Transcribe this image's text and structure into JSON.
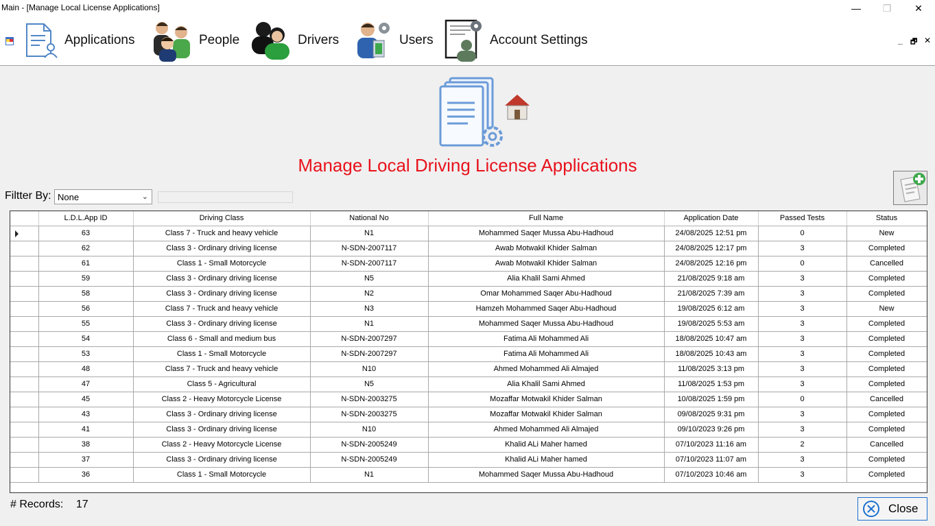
{
  "window": {
    "title": "Main - [Manage Local License Applications]",
    "minimize": "—",
    "maximize": "❐",
    "close": "✕"
  },
  "menu": {
    "items": [
      {
        "label": "Applications",
        "icon": "applications-icon"
      },
      {
        "label": "People",
        "icon": "people-icon"
      },
      {
        "label": "Drivers",
        "icon": "drivers-icon"
      },
      {
        "label": "Users",
        "icon": "users-icon"
      },
      {
        "label": "Account Settings",
        "icon": "account-settings-icon"
      }
    ],
    "mdi_controls": {
      "minimize": "_",
      "restore": "🗗",
      "close": "✕"
    }
  },
  "page": {
    "title": "Manage Local Driving License Applications",
    "title_color": "#e8121c"
  },
  "filter": {
    "label": "Filtter By:",
    "selected": "None",
    "text_value": ""
  },
  "table": {
    "columns": [
      "L.D.L.App ID",
      "Driving Class",
      "National No",
      "Full Name",
      "Application Date",
      "Passed Tests",
      "Status"
    ],
    "rows": [
      [
        "63",
        "Class 7 - Truck and heavy vehicle",
        "N1",
        "Mohammed Saqer Mussa Abu-Hadhoud",
        "24/08/2025 12:51 pm",
        "0",
        "New"
      ],
      [
        "62",
        "Class 3 - Ordinary driving license",
        "N-SDN-2007117",
        "Awab Motwakil Khider Salman",
        "24/08/2025 12:17 pm",
        "3",
        "Completed"
      ],
      [
        "61",
        "Class 1 - Small Motorcycle",
        "N-SDN-2007117",
        "Awab Motwakil Khider Salman",
        "24/08/2025 12:16 pm",
        "0",
        "Cancelled"
      ],
      [
        "59",
        "Class 3 - Ordinary driving license",
        "N5",
        "Alia Khalil Sami Ahmed",
        "21/08/2025 9:18 am",
        "3",
        "Completed"
      ],
      [
        "58",
        "Class 3 - Ordinary driving license",
        "N2",
        "Omar Mohammed Saqer Abu-Hadhoud",
        "21/08/2025 7:39 am",
        "3",
        "Completed"
      ],
      [
        "56",
        "Class 7 - Truck and heavy vehicle",
        "N3",
        "Hamzeh Mohammed Saqer Abu-Hadhoud",
        "19/08/2025 6:12 am",
        "3",
        "New"
      ],
      [
        "55",
        "Class 3 - Ordinary driving license",
        "N1",
        "Mohammed Saqer Mussa Abu-Hadhoud",
        "19/08/2025 5:53 am",
        "3",
        "Completed"
      ],
      [
        "54",
        "Class 6 - Small and medium bus",
        "N-SDN-2007297",
        "Fatima Ali Mohammed Ali",
        "18/08/2025 10:47 am",
        "3",
        "Completed"
      ],
      [
        "53",
        "Class 1 - Small Motorcycle",
        "N-SDN-2007297",
        "Fatima Ali Mohammed Ali",
        "18/08/2025 10:43 am",
        "3",
        "Completed"
      ],
      [
        "48",
        "Class 7 - Truck and heavy vehicle",
        "N10",
        "Ahmed Mohammed Ali Almajed",
        "11/08/2025 3:13 pm",
        "3",
        "Completed"
      ],
      [
        "47",
        "Class 5 - Agricultural",
        "N5",
        "Alia Khalil Sami Ahmed",
        "11/08/2025 1:53 pm",
        "3",
        "Completed"
      ],
      [
        "45",
        "Class 2 - Heavy Motorcycle License",
        "N-SDN-2003275",
        "Mozaffar Motwakil Khider Salman",
        "10/08/2025 1:59 pm",
        "0",
        "Cancelled"
      ],
      [
        "43",
        "Class 3 - Ordinary driving license",
        "N-SDN-2003275",
        "Mozaffar Motwakil Khider Salman",
        "09/08/2025 9:31 pm",
        "3",
        "Completed"
      ],
      [
        "41",
        "Class 3 - Ordinary driving license",
        "N10",
        "Ahmed Mohammed Ali Almajed",
        "09/10/2023 9:26 pm",
        "3",
        "Completed"
      ],
      [
        "38",
        "Class 2 - Heavy Motorcycle License",
        "N-SDN-2005249",
        "Khalid ALi Maher hamed",
        "07/10/2023 11:16 am",
        "2",
        "Cancelled"
      ],
      [
        "37",
        "Class 3 - Ordinary driving license",
        "N-SDN-2005249",
        "Khalid ALi Maher hamed",
        "07/10/2023 11:07 am",
        "3",
        "Completed"
      ],
      [
        "36",
        "Class 1 - Small Motorcycle",
        "N1",
        "Mohammed Saqer Mussa Abu-Hadhoud",
        "07/10/2023 10:46 am",
        "3",
        "Completed"
      ]
    ]
  },
  "footer": {
    "records_label": "# Records:",
    "records_count": "17",
    "close_label": "Close"
  },
  "colors": {
    "accent_blue": "#1a6fd0",
    "title_red": "#e8121c"
  }
}
